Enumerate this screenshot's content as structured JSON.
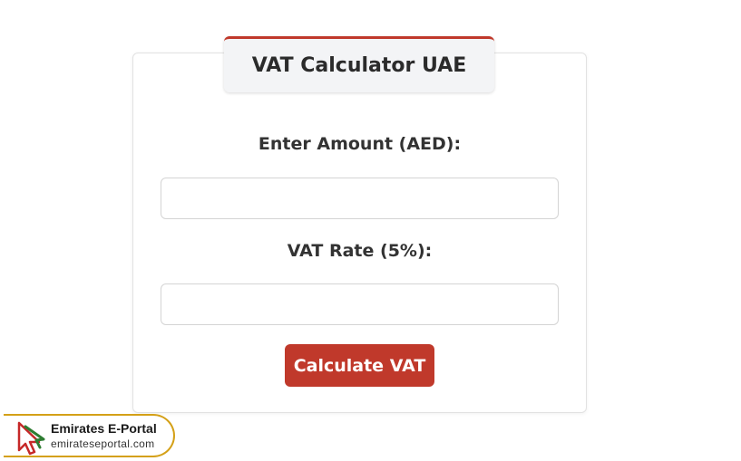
{
  "header": {
    "title": "VAT Calculator UAE"
  },
  "form": {
    "amount_label": "Enter Amount (AED):",
    "amount_value": "",
    "rate_label": "VAT Rate (5%):",
    "rate_value": "",
    "calculate_label": "Calculate VAT"
  },
  "watermark": {
    "name": "Emirates E-Portal",
    "url": "emirateseportal.com",
    "icon": "cursor-arrow-icon"
  },
  "colors": {
    "accent": "#c0392b",
    "badge_border": "#d4a017",
    "logo_green": "#2e7d32",
    "logo_red": "#c62828"
  }
}
